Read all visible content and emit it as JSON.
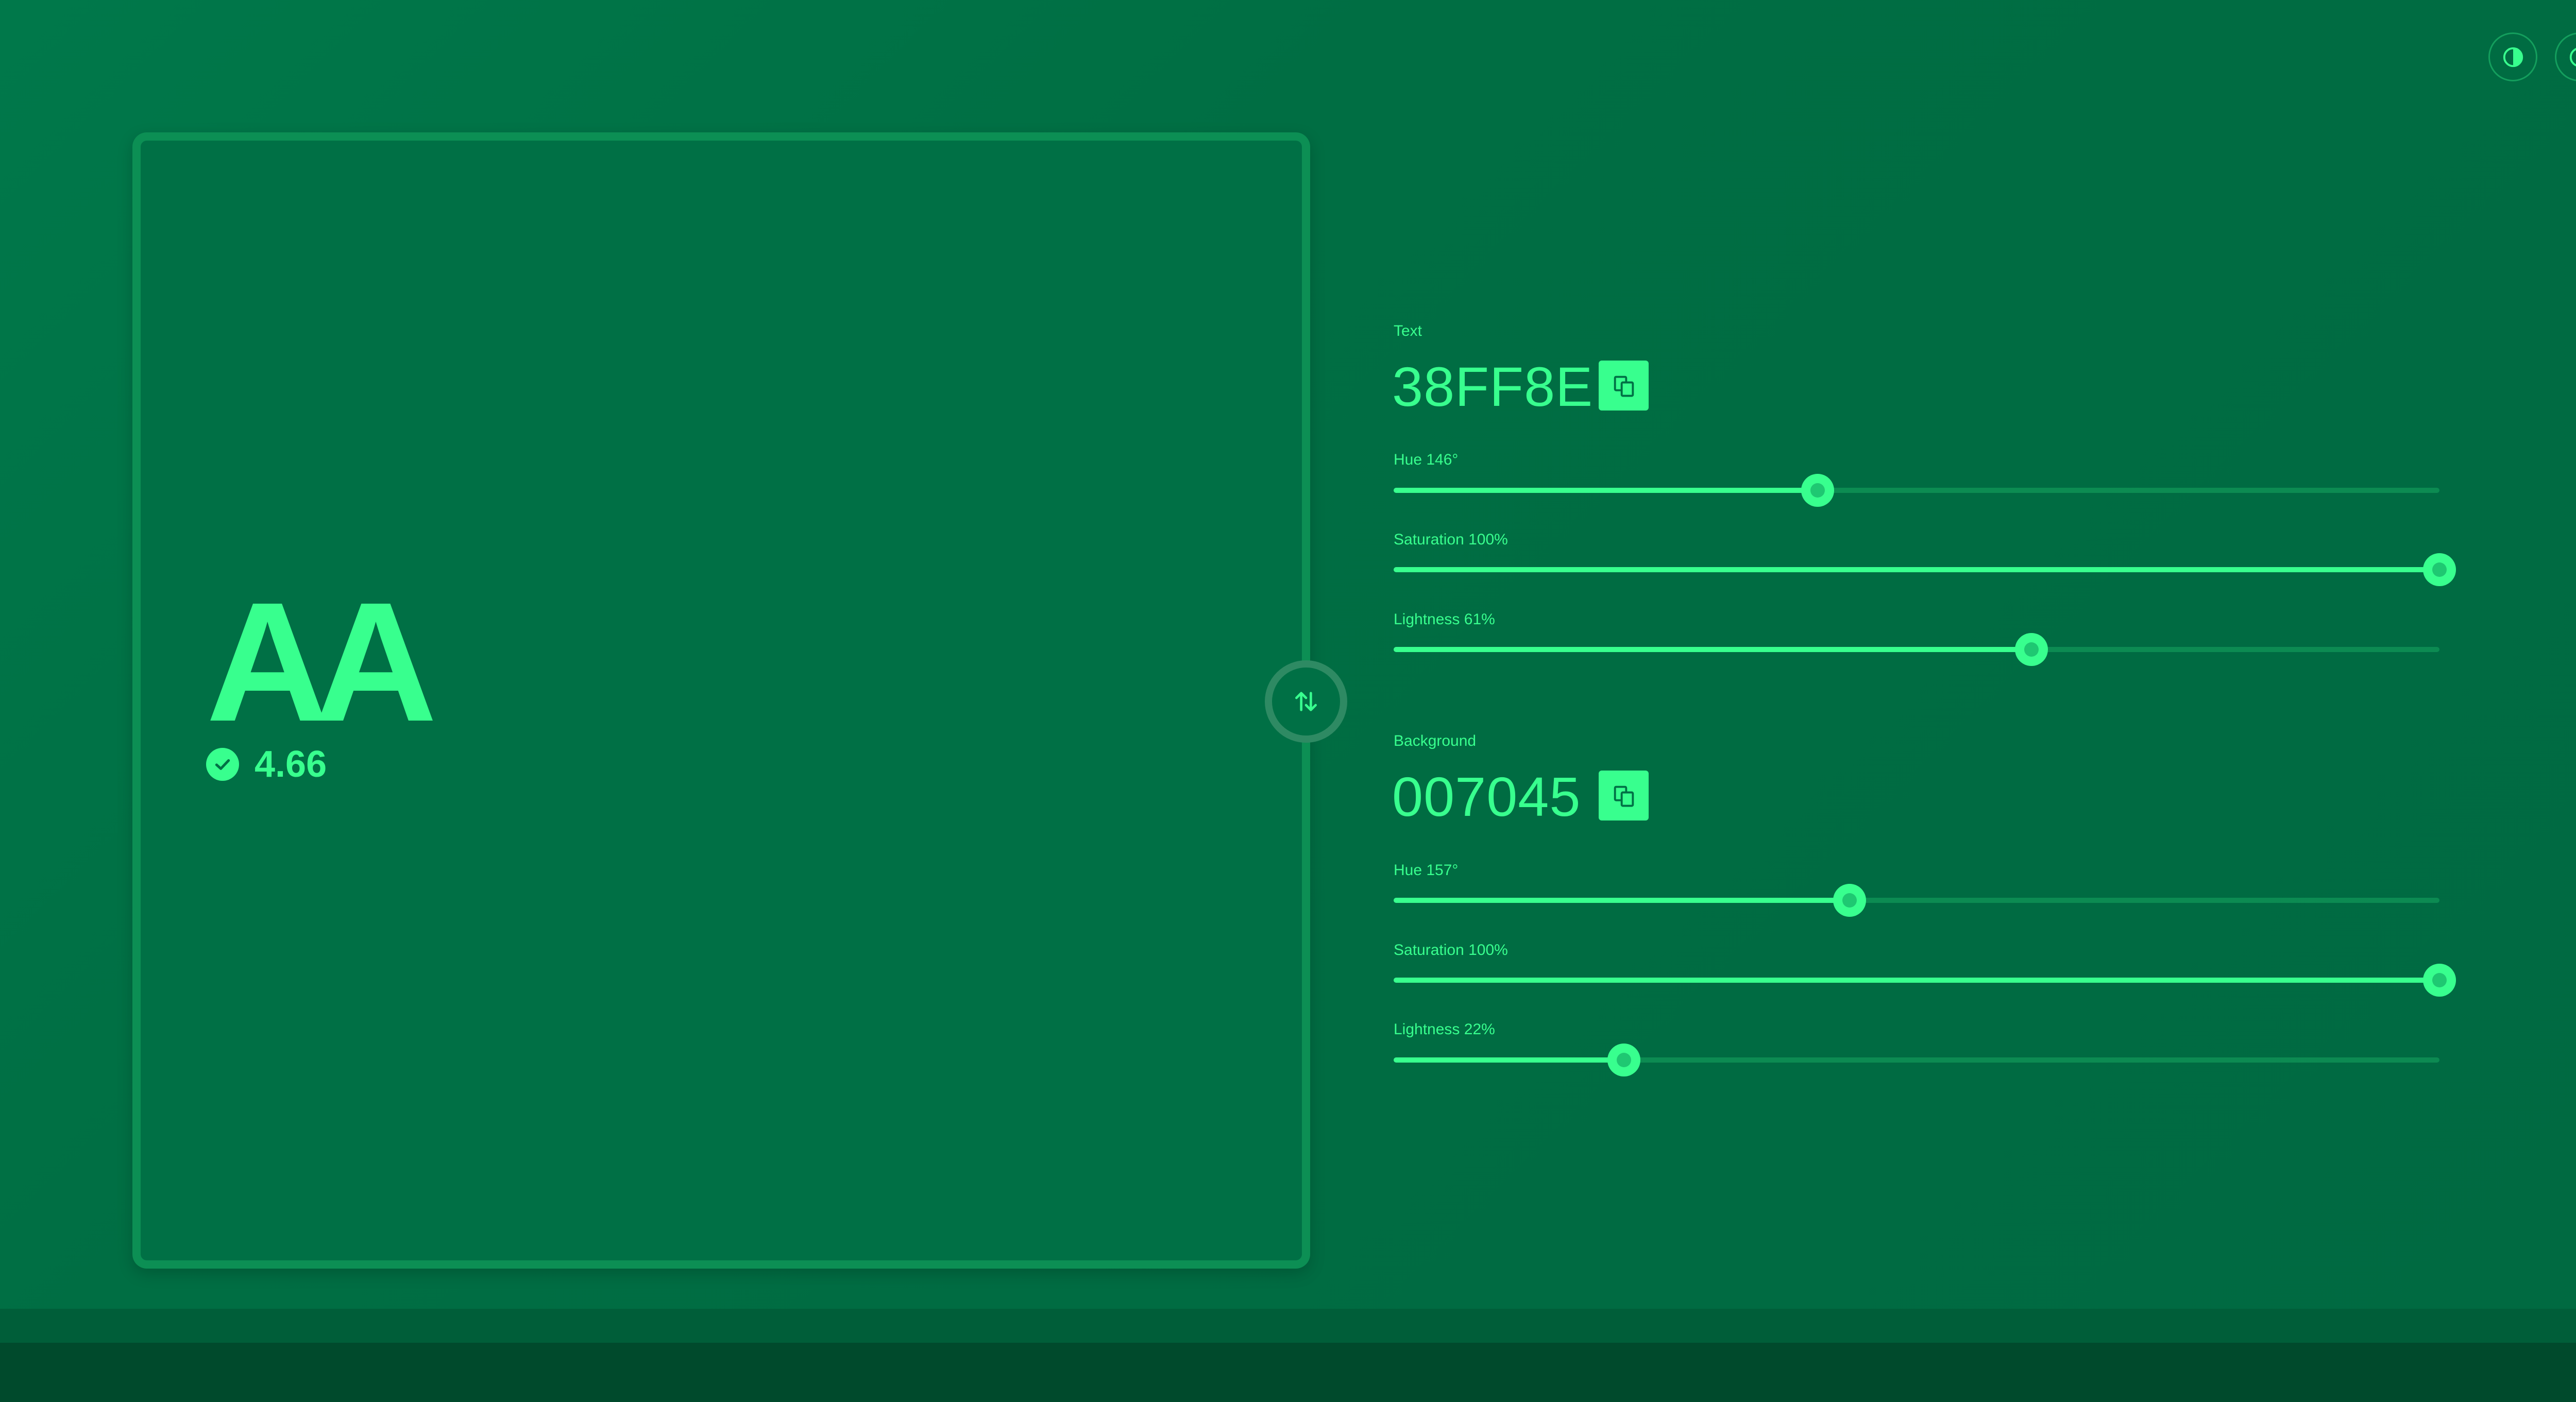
{
  "colors": {
    "text_color": "#38FF8E",
    "background_color": "#007045"
  },
  "header": {
    "icons": [
      "contrast-icon",
      "info-icon"
    ]
  },
  "preview": {
    "sample_text": "AA",
    "contrast_ratio": "4.66",
    "status_icon": "check-icon",
    "swap_icon": "swap-arrows-icon"
  },
  "text_color": {
    "section_label": "Text",
    "hex": "38FF8E",
    "copy_icon": "copy-icon",
    "sliders": [
      {
        "label": "Hue 146°",
        "value": 146,
        "max": 360
      },
      {
        "label": "Saturation 100%",
        "value": 100,
        "max": 100
      },
      {
        "label": "Lightness 61%",
        "value": 61,
        "max": 100
      }
    ]
  },
  "background_color": {
    "section_label": "Background",
    "hex": "007045",
    "copy_icon": "copy-icon",
    "sliders": [
      {
        "label": "Hue 157°",
        "value": 157,
        "max": 360
      },
      {
        "label": "Saturation 100%",
        "value": 100,
        "max": 100
      },
      {
        "label": "Lightness 22%",
        "value": 22,
        "max": 100
      }
    ]
  }
}
